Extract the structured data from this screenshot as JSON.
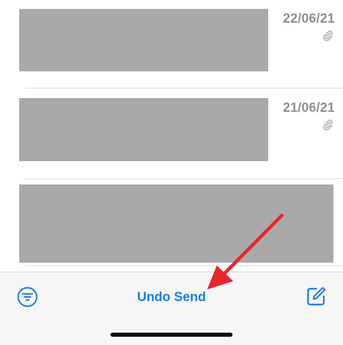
{
  "mail_list": {
    "rows": [
      {
        "date": "22/06/21",
        "has_attachment": true
      },
      {
        "date": "21/06/21",
        "has_attachment": true
      },
      {
        "date": "",
        "has_attachment": false
      }
    ]
  },
  "toolbar": {
    "filter_icon": "filter-icon",
    "undo_send_label": "Undo Send",
    "compose_icon": "compose-icon"
  },
  "annotation": {
    "arrow_color": "#e8262a"
  },
  "colors": {
    "accent": "#1a7ee6",
    "date_gray": "#8e8e93",
    "redacted": "#a9a9a9"
  }
}
